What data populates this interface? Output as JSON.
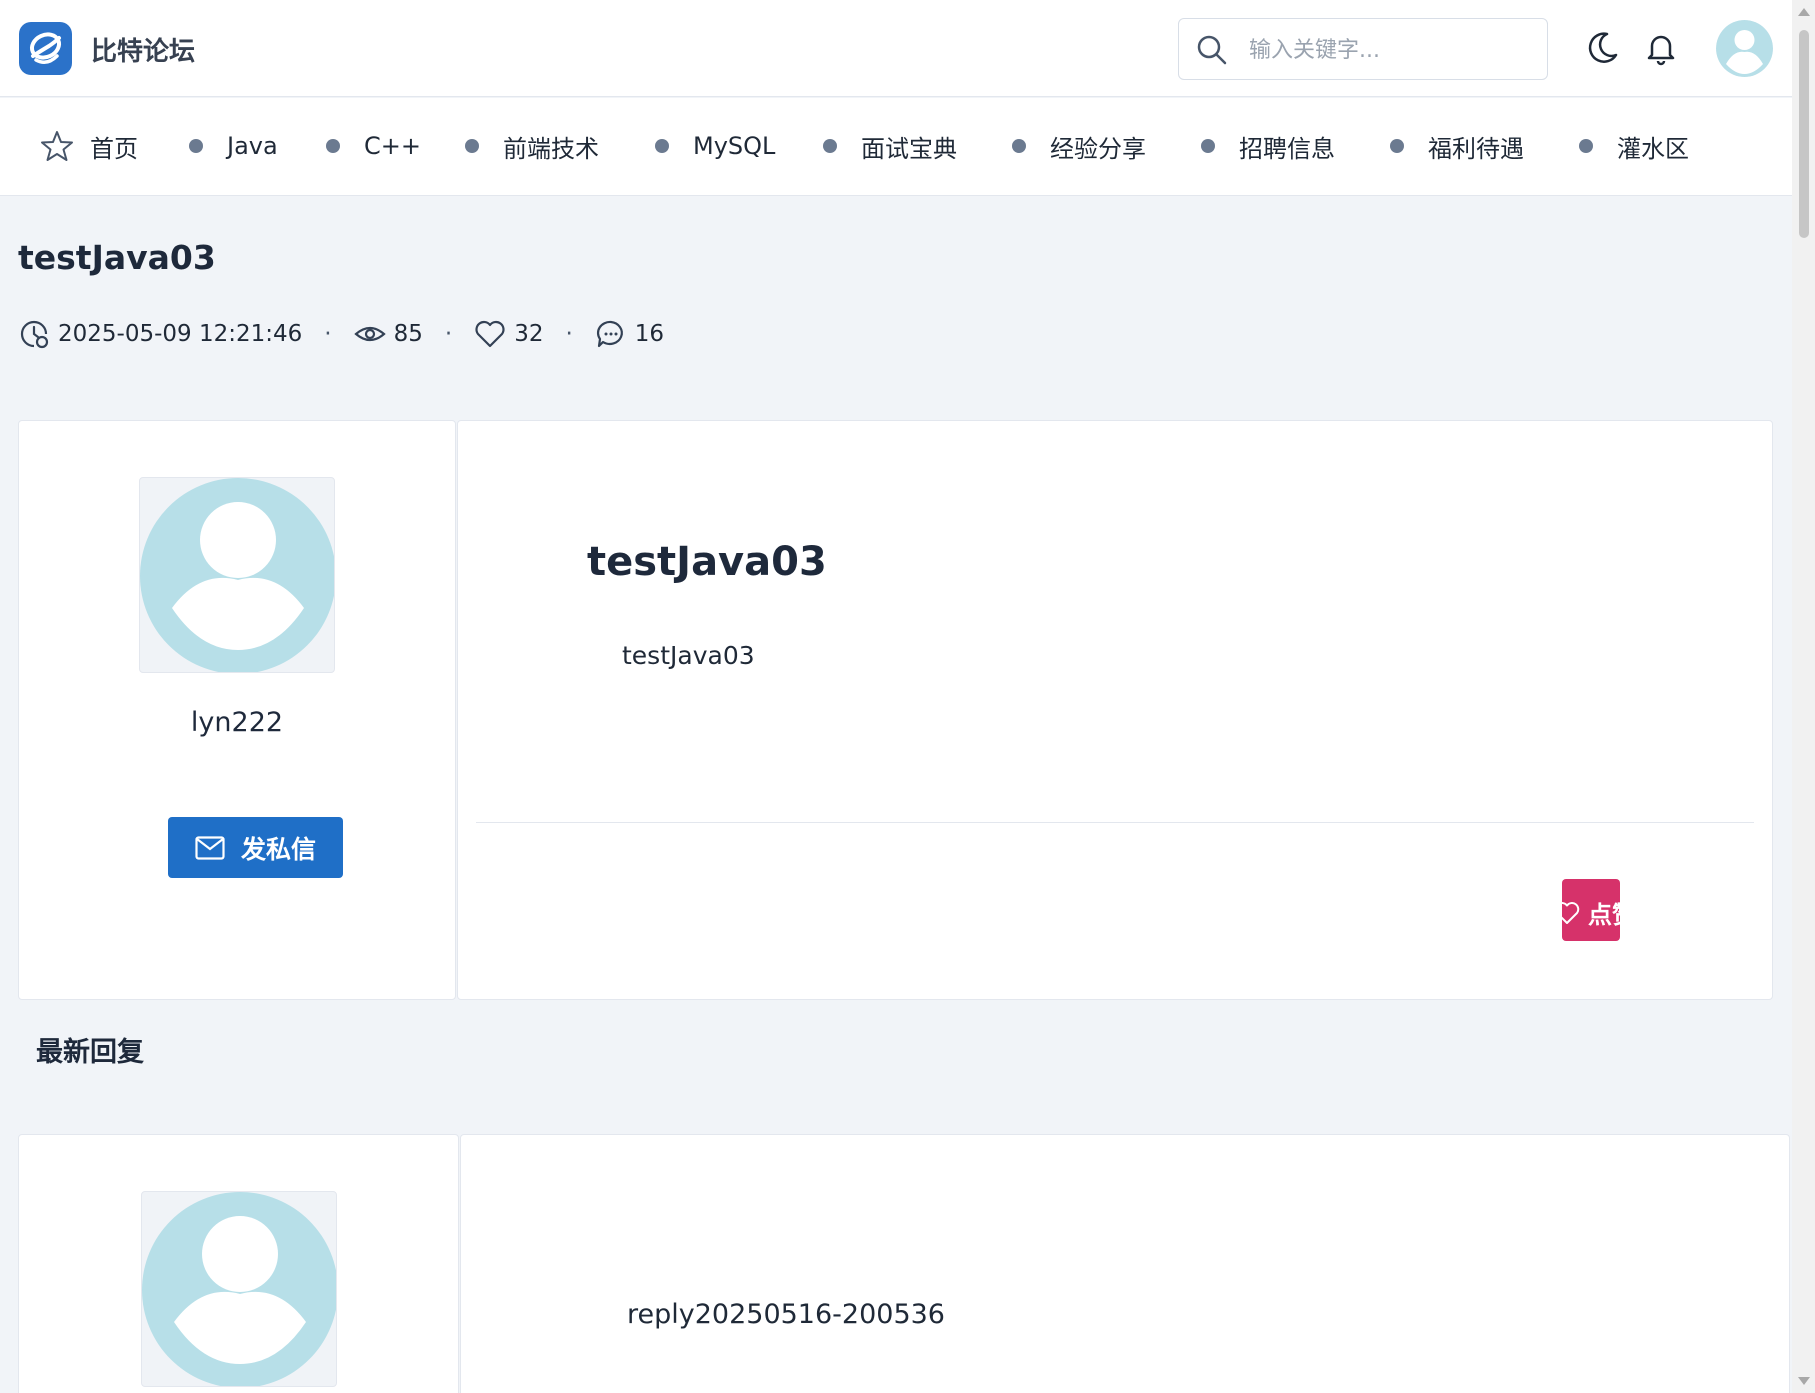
{
  "header": {
    "brand": "比特论坛",
    "search_placeholder": "输入关键字..."
  },
  "nav": {
    "items": [
      {
        "label": "首页",
        "icon": "star-icon"
      },
      {
        "label": "Java"
      },
      {
        "label": "C++"
      },
      {
        "label": "前端技术"
      },
      {
        "label": "MySQL"
      },
      {
        "label": "面试宝典"
      },
      {
        "label": "经验分享"
      },
      {
        "label": "招聘信息"
      },
      {
        "label": "福利待遇"
      },
      {
        "label": "灌水区"
      }
    ]
  },
  "post": {
    "title": "testJava03",
    "datetime": "2025-05-09 12:21:46",
    "views": "85",
    "likes": "32",
    "comments": "16",
    "author": "lyn222",
    "message_button": "发私信",
    "heading": "testJava03",
    "body": "testJava03",
    "like_button": "点赞"
  },
  "replies": {
    "section_title": "最新回复",
    "items": [
      {
        "body": "reply20250516-200536"
      }
    ]
  },
  "colors": {
    "primary": "#1f6fc7",
    "like": "#d6326a",
    "avatar": "#b7dfe8",
    "background": "#f1f4f8"
  }
}
